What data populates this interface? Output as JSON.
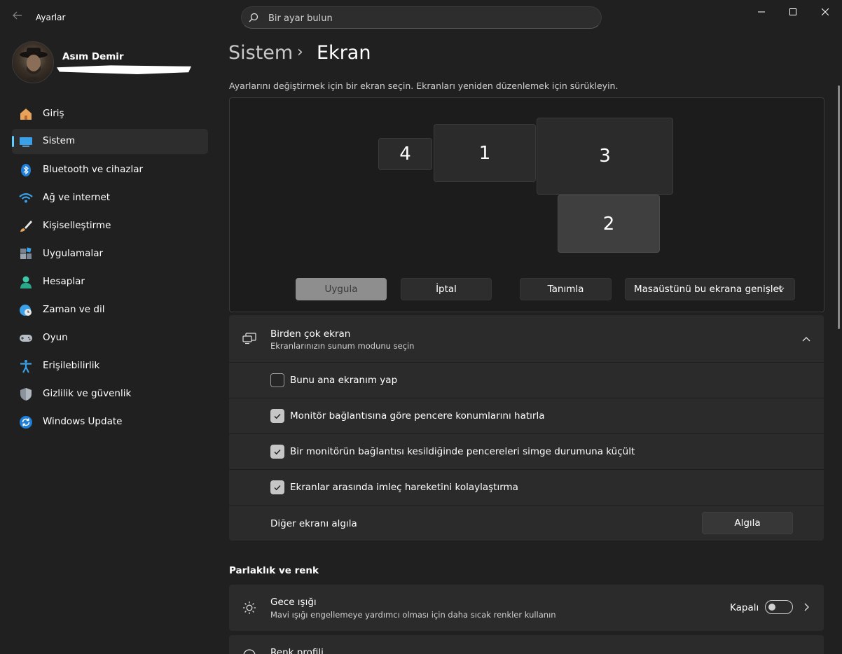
{
  "window": {
    "title": "Ayarlar",
    "minimize_icon": "minimize-icon",
    "maximize_icon": "maximize-icon",
    "close_icon": "close-icon"
  },
  "search": {
    "placeholder": "Bir ayar bulun"
  },
  "user": {
    "name": "Asım Demir"
  },
  "sidebar": {
    "items": [
      {
        "label": "Giriş",
        "icon": "home-icon"
      },
      {
        "label": "Sistem",
        "icon": "system-icon",
        "active": true
      },
      {
        "label": "Bluetooth ve cihazlar",
        "icon": "bluetooth-icon"
      },
      {
        "label": "Ağ ve internet",
        "icon": "wifi-icon"
      },
      {
        "label": "Kişiselleştirme",
        "icon": "brush-icon"
      },
      {
        "label": "Uygulamalar",
        "icon": "apps-icon"
      },
      {
        "label": "Hesaplar",
        "icon": "account-icon"
      },
      {
        "label": "Zaman ve dil",
        "icon": "globe-clock-icon"
      },
      {
        "label": "Oyun",
        "icon": "gamepad-icon"
      },
      {
        "label": "Erişilebilirlik",
        "icon": "accessibility-icon"
      },
      {
        "label": "Gizlilik ve güvenlik",
        "icon": "shield-icon"
      },
      {
        "label": "Windows Update",
        "icon": "update-icon"
      }
    ]
  },
  "header": {
    "breadcrumb_parent": "Sistem",
    "breadcrumb_separator": "›",
    "title": "Ekran"
  },
  "arrangement": {
    "instruction": "Ayarlarını değiştirmek için bir ekran seçin. Ekranları yeniden düzenlemek için sürükleyin.",
    "monitors": [
      "4",
      "1",
      "3",
      "2"
    ],
    "selected_monitor": "2",
    "apply_label": "Uygula",
    "cancel_label": "İptal",
    "identify_label": "Tanımla",
    "mode_select_value": "Masaüstünü bu ekrana genişlet"
  },
  "multiple_displays": {
    "title": "Birden çok ekran",
    "subtitle": "Ekranlarınızın sunum modunu seçin",
    "options": [
      {
        "label": "Bunu ana ekranım yap",
        "checked": false
      },
      {
        "label": "Monitör bağlantısına göre pencere konumlarını hatırla",
        "checked": true
      },
      {
        "label": "Bir monitörün bağlantısı kesildiğinde pencereleri simge durumuna küçült",
        "checked": true
      },
      {
        "label": "Ekranlar arasında imleç hareketini kolaylaştırma",
        "checked": true
      }
    ],
    "detect_label": "Diğer ekranı algıla",
    "detect_button": "Algıla"
  },
  "brightness": {
    "heading": "Parlaklık ve renk",
    "night_light_title": "Gece ışığı",
    "night_light_subtitle": "Mavi ışığı engellemeye yardımcı olması için daha sıcak renkler kullanın",
    "night_light_state": "Kapalı",
    "night_light_on": false,
    "color_profile_title": "Renk profili"
  },
  "colors": {
    "accent": "#60cdff",
    "background": "#202020",
    "card": "#2b2b2b"
  }
}
